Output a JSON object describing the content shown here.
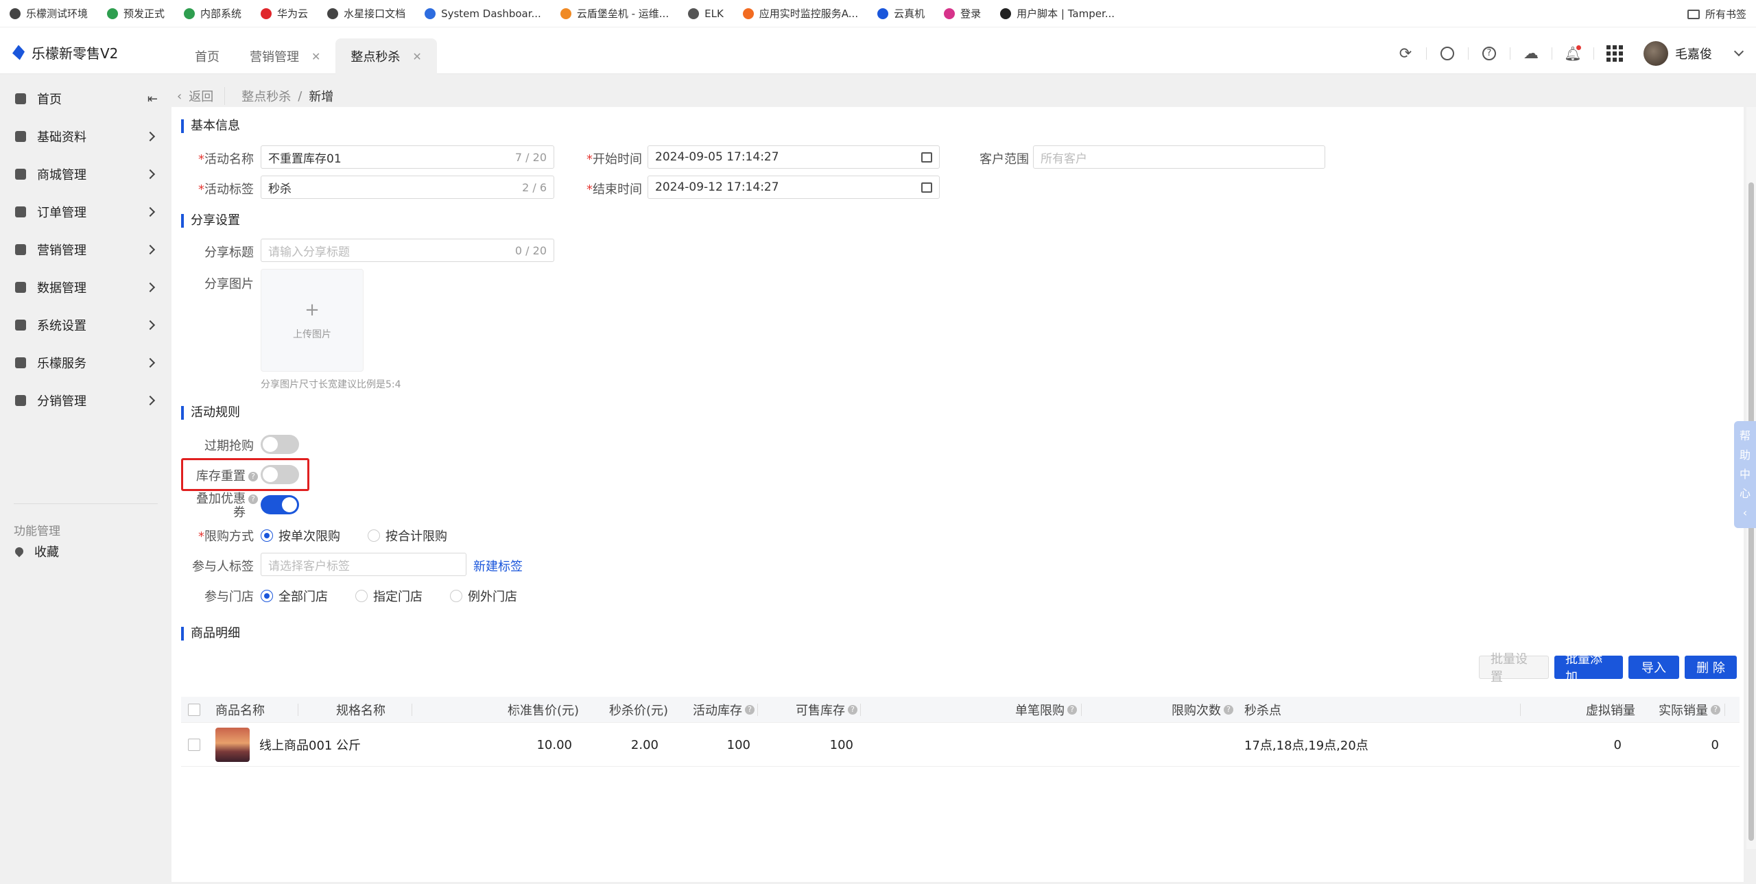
{
  "bookmarks": {
    "items": [
      {
        "label": "乐檬测试环境",
        "color": "#444"
      },
      {
        "label": "预发正式",
        "color": "#2e9e4f"
      },
      {
        "label": "内部系统",
        "color": "#2e9e4f"
      },
      {
        "label": "华为云",
        "color": "#e0262b"
      },
      {
        "label": "水星接口文档",
        "color": "#444"
      },
      {
        "label": "System Dashboar...",
        "color": "#2d6cdf"
      },
      {
        "label": "云盾堡垒机 - 运维...",
        "color": "#f08a24"
      },
      {
        "label": "ELK",
        "color": "#555"
      },
      {
        "label": "应用实时监控服务A...",
        "color": "#f26b21"
      },
      {
        "label": "云真机",
        "color": "#1a56db"
      },
      {
        "label": "登录",
        "color": "#d6338a"
      },
      {
        "label": "用户脚本 | Tamper...",
        "color": "#222"
      }
    ],
    "all_label": "所有书签"
  },
  "header": {
    "app_name": "乐檬新零售V2",
    "tabs": [
      {
        "label": "首页",
        "closable": false,
        "active": false
      },
      {
        "label": "营销管理",
        "closable": true,
        "active": false
      },
      {
        "label": "整点秒杀",
        "closable": true,
        "active": true
      }
    ],
    "user_name": "毛嘉俊"
  },
  "sidebar": {
    "items": [
      {
        "label": "首页",
        "icon": "home-icon"
      },
      {
        "label": "基础资料",
        "icon": "cube-icon"
      },
      {
        "label": "商城管理",
        "icon": "store-icon"
      },
      {
        "label": "订单管理",
        "icon": "order-icon"
      },
      {
        "label": "营销管理",
        "icon": "marketing-icon"
      },
      {
        "label": "数据管理",
        "icon": "pie-chart-icon"
      },
      {
        "label": "系统设置",
        "icon": "settings-icon"
      },
      {
        "label": "乐檬服务",
        "icon": "service-icon"
      },
      {
        "label": "分销管理",
        "icon": "distribution-icon"
      }
    ],
    "group_title": "功能管理",
    "favorites_label": "收藏"
  },
  "breadcrumb": {
    "back": "返回",
    "parent": "整点秒杀",
    "sep": "/",
    "current": "新增"
  },
  "form": {
    "basic_title": "基本信息",
    "activity_name_label": "活动名称",
    "activity_name_value": "不重置库存01",
    "activity_name_count": "7 / 20",
    "activity_tag_label": "活动标签",
    "activity_tag_value": "秒杀",
    "activity_tag_count": "2 / 6",
    "start_label": "开始时间",
    "start_value": "2024-09-05 17:14:27",
    "end_label": "结束时间",
    "end_value": "2024-09-12 17:14:27",
    "customer_label": "客户范围",
    "customer_placeholder": "所有客户",
    "share_title": "分享设置",
    "share_title_label": "分享标题",
    "share_title_placeholder": "请输入分享标题",
    "share_title_count": "0 / 20",
    "share_image_label": "分享图片",
    "upload_label": "上传图片",
    "upload_hint": "分享图片尺寸长宽建议比例是5:4",
    "rules_title": "活动规则",
    "expired_label": "过期抢购",
    "stock_reset_label": "库存重置",
    "coupon_label_1": "叠加优惠",
    "coupon_label_2": "券",
    "limit_label": "限购方式",
    "limit_options": [
      "按单次限购",
      "按合计限购"
    ],
    "tag_label": "参与人标签",
    "tag_placeholder": "请选择客户标签",
    "new_tag_link": "新建标签",
    "store_label": "参与门店",
    "store_options": [
      "全部门店",
      "指定门店",
      "例外门店"
    ],
    "switches": {
      "expired": false,
      "stock_reset": false,
      "coupon": true
    }
  },
  "products": {
    "title": "商品明细",
    "buttons": {
      "batch_set": "批量设置",
      "batch_add": "批量添加",
      "import": "导入",
      "delete": "删 除"
    },
    "columns": [
      "商品名称",
      "规格名称",
      "标准售价(元)",
      "秒杀价(元)",
      "活动库存",
      "可售库存",
      "单笔限购",
      "限购次数",
      "秒杀点",
      "虚拟销量",
      "实际销量"
    ],
    "rows": [
      {
        "name": "线上商品001",
        "spec": "公斤",
        "std_price": "10.00",
        "sec_price": "2.00",
        "act_stock": "100",
        "avail_stock": "100",
        "single_limit": "",
        "limit_times": "",
        "points": "17点,18点,19点,20点",
        "virtual_sales": "0",
        "actual_sales": "0"
      }
    ]
  },
  "help": {
    "chars": [
      "帮",
      "助",
      "中",
      "心"
    ]
  },
  "colors": {
    "accent": "#1a56db",
    "highlight": "#e02020"
  }
}
